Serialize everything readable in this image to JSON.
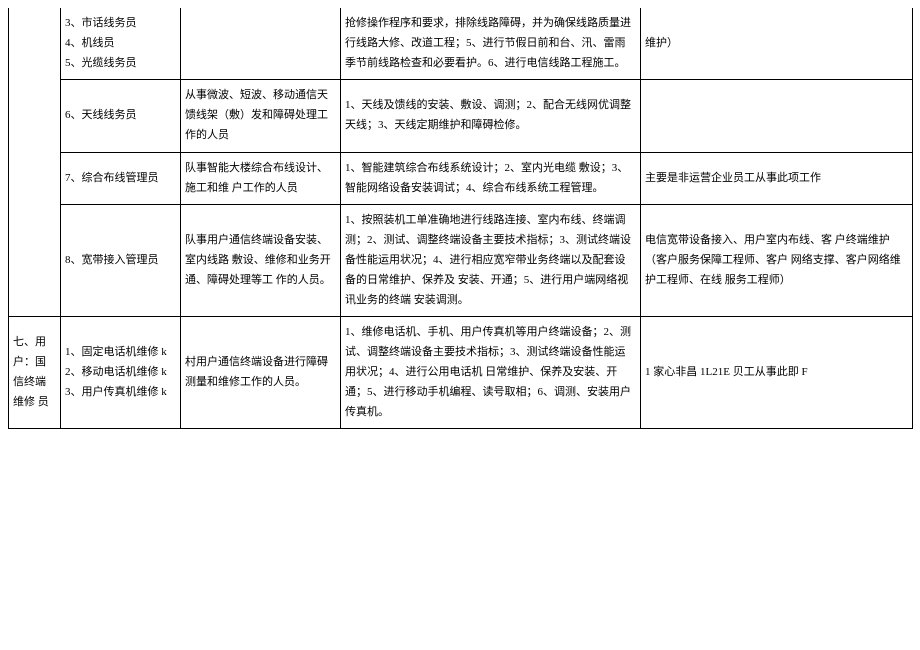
{
  "rows": {
    "r0": {
      "colA": "",
      "colB": "3、市话线务员\n4、机线员\n5、光缆线务员",
      "colC": "",
      "colD": "抢修操作程序和要求，排除线路障碍，并为确保线路质量进行线路大修、改道工程；5、进行节假日前和台、汛、雷雨季节前线路检查和必要看护。6、进行电信线路工程施工。",
      "colE": "维护）"
    },
    "r1": {
      "colB": "6、天线线务员",
      "colC": "从事微波、短波、移动通信天馈线架（敷）发和障碍处理工作的人员",
      "colD": "1、天线及馈线的安装、敷设、调测；2、配合无线网优调整天线；3、天线定期维护和障碍检修。",
      "colE": ""
    },
    "r2": {
      "colB": "7、综合布线管理员",
      "colC": "队事智能大楼综合布线设计、施工和维 户工作的人员",
      "colD": "1、智能建筑综合布线系统设计；2、室内光电缆 敷设；3、智能网络设备安装调试；4、综合布线系统工程管理。",
      "colE": "主要是非运营企业员工从事此项工作"
    },
    "r3": {
      "colB": "8、宽带接入管理员",
      "colC": "队事用户通信终端设备安装、室内线路 敷设、维修和业务开通、障碍处理等工 作的人员。",
      "colD": "1、按照装机工单准确地进行线路连接、室内布线、终端调测；2、测试、调整终端设备主要技术指标；3、测试终端设备性能运用状况；4、进行相应宽窄带业务终端以及配套设备的日常维护、保养及 安装、开通；5、进行用户端网络视讯业务的终端 安装调测。",
      "colE": "电信宽带设备接入、用户室内布线、客 户终端维护（客户服务保障工程师、客户 网络支撑、客户网络维护工程师、在线 服务工程师）"
    },
    "r4": {
      "colA": "七、用户：国信终端维修 员",
      "colB": "1、固定电话机维修 k\n2、移动电话机维修 k\n3、用户传真机维修 k",
      "colC": "村用户通信终端设备进行障碍测量和维修工作的人员。",
      "colD": "1、维修电话机、手机、用户传真机等用户终端设备；2、测试、调整终端设备主要技术指标；3、测试终端设备性能运用状况；4、进行公用电话机 日常维护、保养及安装、开通；5、进行移动手机编程、读号取相；6、调测、安装用户传真机。",
      "colE": "1 家心非昌 1L21E 贝工从事此即 F"
    }
  }
}
